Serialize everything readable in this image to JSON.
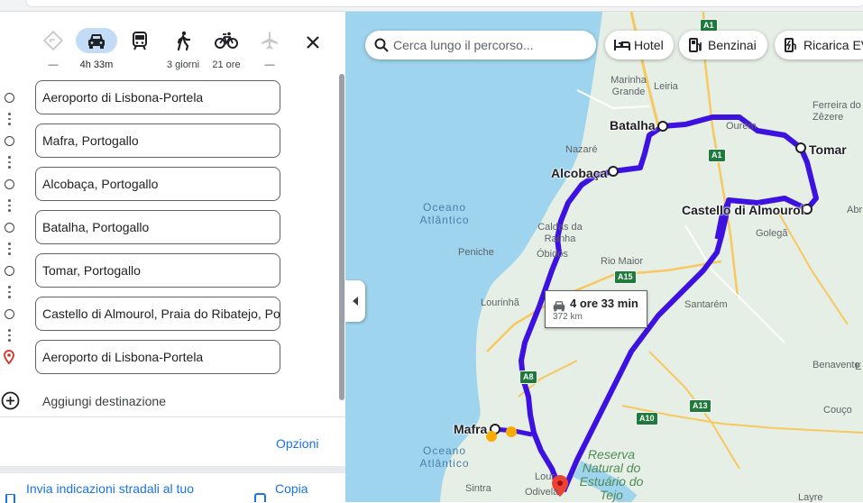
{
  "modes": [
    {
      "name": "best-route",
      "label": "—",
      "active": false,
      "disabled": true
    },
    {
      "name": "driving",
      "label": "4h 33m",
      "active": true,
      "disabled": false
    },
    {
      "name": "transit",
      "label": "",
      "active": false,
      "disabled": false
    },
    {
      "name": "walking",
      "label": "3 giorni",
      "active": false,
      "disabled": false
    },
    {
      "name": "cycling",
      "label": "21 ore",
      "active": false,
      "disabled": false
    },
    {
      "name": "flights",
      "label": "—",
      "active": false,
      "disabled": true
    }
  ],
  "stops": [
    {
      "value": "Aeroporto di Lisbona-Portela",
      "type": "waypoint"
    },
    {
      "value": "Mafra, Portogallo",
      "type": "waypoint"
    },
    {
      "value": "Alcobaça, Portogallo",
      "type": "waypoint"
    },
    {
      "value": "Batalha, Portogallo",
      "type": "waypoint"
    },
    {
      "value": "Tomar, Portogallo",
      "type": "waypoint"
    },
    {
      "value": "Castello di Almourol, Praia do Ribatejo, Portogallo",
      "type": "waypoint"
    },
    {
      "value": "Aeroporto di Lisbona-Portela",
      "type": "destination"
    }
  ],
  "add_destination": "Aggiungi destinazione",
  "options": "Opzioni",
  "send_directions": "Invia indicazioni stradali al tuo",
  "copy": "Copia",
  "search": {
    "placeholder": "Cerca lungo il percorso..."
  },
  "chips": [
    "Hotel",
    "Benzinai",
    "Ricarica EV"
  ],
  "route_bubble": {
    "time": "4 ore 33 min",
    "distance": "372 km"
  },
  "map_labels": {
    "cities": [
      "Batalha",
      "Tomar",
      "Alcobaça",
      "Castello di Almourol",
      "Mafra"
    ],
    "places": [
      "Marinha Grande",
      "Leiria",
      "Ferreira do Zêzere",
      "Ourém",
      "Nazaré",
      "Caldas da Rainha",
      "Óbidos",
      "Peniche",
      "Rio Maior",
      "Golegã",
      "Abr",
      "Lourinhã",
      "Santarém",
      "Benavente",
      "Couço",
      "Sintra",
      "Odivela",
      "Lour",
      "Layre",
      "E"
    ],
    "oceans": [
      "Oceano Atlântico",
      "Oceano Atlântico"
    ],
    "reserve": "Reserva Natural do Estuário do Tejo",
    "roads": [
      "A1",
      "A1",
      "A15",
      "A8",
      "A10",
      "A13"
    ]
  },
  "colors": {
    "route": "#3d12e0",
    "accent": "#1a73e8",
    "water": "#9fd4ee",
    "land": "#e6efe6",
    "highway": "#f6c85f"
  }
}
